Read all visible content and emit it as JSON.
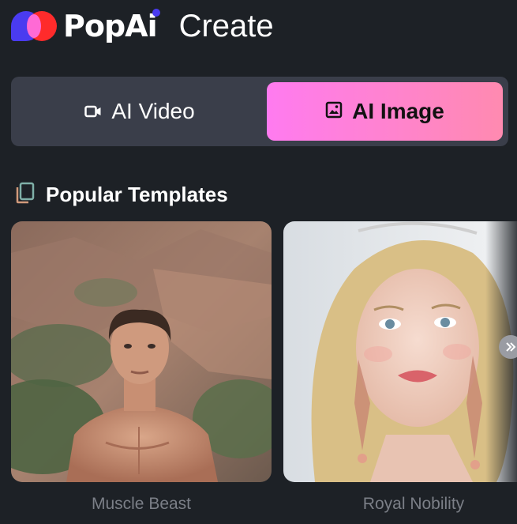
{
  "header": {
    "brand": "PopAi",
    "title": "Create"
  },
  "mode_switch": {
    "tabs": [
      {
        "label": "AI Video",
        "icon": "video-camera-icon",
        "active": false
      },
      {
        "label": "AI Image",
        "icon": "image-icon",
        "active": true
      }
    ]
  },
  "section": {
    "title": "Popular Templates",
    "icon": "copy-stack-icon"
  },
  "templates": [
    {
      "caption": "Muscle Beast"
    },
    {
      "caption": "Royal Nobility"
    }
  ],
  "carousel": {
    "next_icon": "double-chevron-right-icon"
  },
  "colors": {
    "background": "#1d2126",
    "switch_background": "#3a3e4a",
    "active_tab_gradient_start": "#ff7bf0",
    "active_tab_gradient_end": "#ff8ab0",
    "caption_text": "#7b7f87",
    "brand_blue": "#4a3bf0",
    "brand_red": "#ff2b2b"
  }
}
